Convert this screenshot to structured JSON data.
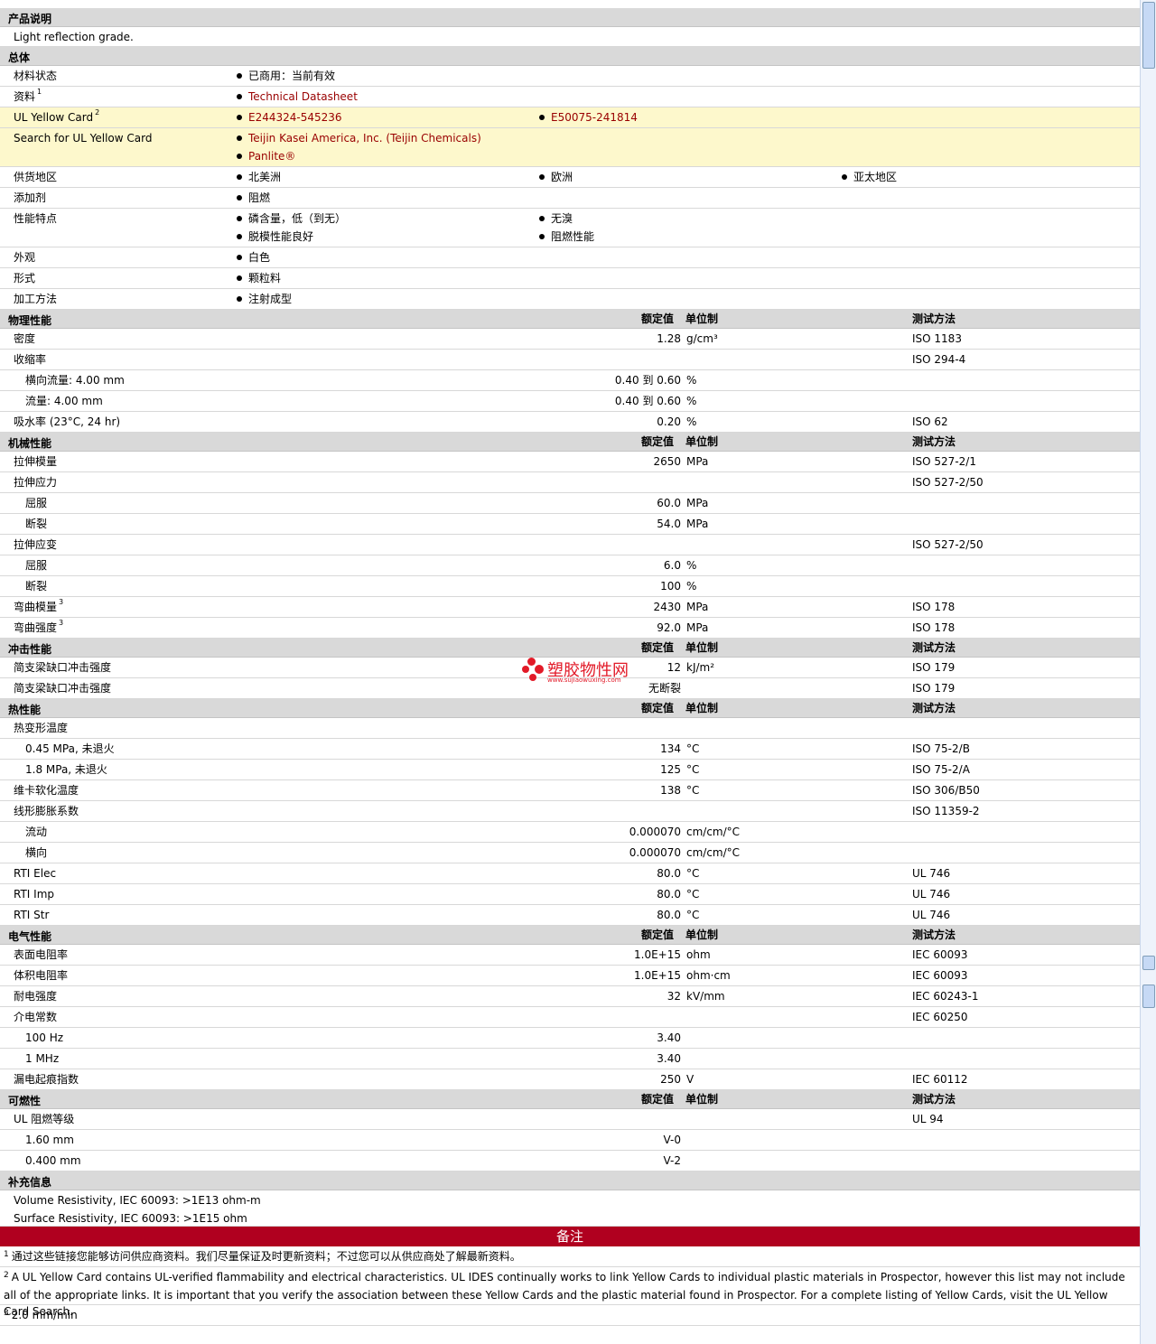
{
  "sections": {
    "desc": "产品说明",
    "general": "总体",
    "physical": "物理性能",
    "mechanical": "机械性能",
    "impact": "冲击性能",
    "thermal": "热性能",
    "electrical": "电气性能",
    "flammability": "可燃性",
    "supplemental": "补充信息"
  },
  "col_headers": {
    "value": "额定值",
    "unit": "单位制",
    "method": "测试方法"
  },
  "description": "Light reflection grade.",
  "general": {
    "status_label": "材料状态",
    "status_value": "已商用：当前有效",
    "docs_label": "资料",
    "docs_sup": "1",
    "docs_value": "Technical Datasheet",
    "ul_label": "UL Yellow Card",
    "ul_sup": "2",
    "ul_links": [
      "E244324-545236",
      "E50075-241814"
    ],
    "search_label": "Search for UL Yellow Card",
    "search_links": [
      "Teijin Kasei America, Inc. (Teijin Chemicals)",
      "Panlite®"
    ],
    "region_label": "供货地区",
    "regions": [
      "北美洲",
      "欧洲",
      "亚太地区"
    ],
    "additive_label": "添加剂",
    "additive": "阻燃",
    "features_label": "性能特点",
    "features": [
      "磷含量，低（到无）",
      "无溴",
      "脱模性能良好",
      "阻燃性能"
    ],
    "appearance_label": "外观",
    "appearance": "白色",
    "form_label": "形式",
    "form": "颗粒料",
    "process_label": "加工方法",
    "process": "注射成型"
  },
  "physical": [
    {
      "label": "密度",
      "value": "1.28",
      "unit": "g/cm³",
      "method": "ISO 1183"
    },
    {
      "label": "收缩率",
      "value": "",
      "unit": "",
      "method": "ISO 294-4"
    },
    {
      "label": "横向流量: 4.00 mm",
      "value": "0.40 到  0.60",
      "unit": "%",
      "method": ""
    },
    {
      "label": "流量: 4.00 mm",
      "value": "0.40 到  0.60",
      "unit": "%",
      "method": ""
    },
    {
      "label": "吸水率 (23°C, 24 hr)",
      "value": "0.20",
      "unit": "%",
      "method": "ISO 62"
    }
  ],
  "mechanical": [
    {
      "label": "拉伸模量",
      "value": "2650",
      "unit": "MPa",
      "method": "ISO 527-2/1"
    },
    {
      "label": "拉伸应力",
      "value": "",
      "unit": "",
      "method": "ISO 527-2/50"
    },
    {
      "label": "屈服",
      "value": "60.0",
      "unit": "MPa",
      "method": ""
    },
    {
      "label": "断裂",
      "value": "54.0",
      "unit": "MPa",
      "method": ""
    },
    {
      "label": "拉伸应变",
      "value": "",
      "unit": "",
      "method": "ISO 527-2/50"
    },
    {
      "label": "屈服",
      "value": "6.0",
      "unit": "%",
      "method": ""
    },
    {
      "label": "断裂",
      "value": "100",
      "unit": "%",
      "method": ""
    },
    {
      "label": "弯曲模量",
      "sup": "3",
      "value": "2430",
      "unit": "MPa",
      "method": "ISO 178"
    },
    {
      "label": "弯曲强度",
      "sup": "3",
      "value": "92.0",
      "unit": "MPa",
      "method": "ISO 178"
    }
  ],
  "impact": [
    {
      "label": "简支梁缺口冲击强度",
      "value": "12",
      "unit": "kJ/m²",
      "method": "ISO 179"
    },
    {
      "label": "简支梁缺口冲击强度",
      "value": "无断裂",
      "unit": "",
      "method": "ISO 179"
    }
  ],
  "thermal": [
    {
      "label": "热变形温度",
      "value": "",
      "unit": "",
      "method": ""
    },
    {
      "label": "0.45 MPa, 未退火",
      "value": "134",
      "unit": "°C",
      "method": "ISO 75-2/B"
    },
    {
      "label": "1.8 MPa, 未退火",
      "value": "125",
      "unit": "°C",
      "method": "ISO 75-2/A"
    },
    {
      "label": "维卡软化温度",
      "value": "138",
      "unit": "°C",
      "method": "ISO 306/B50"
    },
    {
      "label": "线形膨胀系数",
      "value": "",
      "unit": "",
      "method": "ISO 11359-2"
    },
    {
      "label": "流动",
      "value": "0.000070",
      "unit": "cm/cm/°C",
      "method": ""
    },
    {
      "label": "横向",
      "value": "0.000070",
      "unit": "cm/cm/°C",
      "method": ""
    },
    {
      "label": "RTI Elec",
      "value": "80.0",
      "unit": "°C",
      "method": "UL 746"
    },
    {
      "label": "RTI Imp",
      "value": "80.0",
      "unit": "°C",
      "method": "UL 746"
    },
    {
      "label": "RTI Str",
      "value": "80.0",
      "unit": "°C",
      "method": "UL 746"
    }
  ],
  "electrical": [
    {
      "label": "表面电阻率",
      "value": "1.0E+15",
      "unit": "ohm",
      "method": "IEC 60093"
    },
    {
      "label": "体积电阻率",
      "value": "1.0E+15",
      "unit": "ohm·cm",
      "method": "IEC 60093"
    },
    {
      "label": "耐电强度",
      "value": "32",
      "unit": "kV/mm",
      "method": "IEC 60243-1"
    },
    {
      "label": "介电常数",
      "value": "",
      "unit": "",
      "method": "IEC 60250"
    },
    {
      "label": "100 Hz",
      "value": "3.40",
      "unit": "",
      "method": ""
    },
    {
      "label": "1 MHz",
      "value": "3.40",
      "unit": "",
      "method": ""
    },
    {
      "label": "漏电起痕指数",
      "value": "250",
      "unit": "V",
      "method": "IEC 60112"
    }
  ],
  "flammability": [
    {
      "label": "UL 阻燃等级",
      "value": "",
      "unit": "",
      "method": "UL 94"
    },
    {
      "label": "1.60 mm",
      "value": "V-0",
      "unit": "",
      "method": ""
    },
    {
      "label": "0.400 mm",
      "value": "V-2",
      "unit": "",
      "method": ""
    }
  ],
  "supplemental": [
    "Volume Resistivity, IEC 60093: >1E13 ohm-m",
    "Surface Resistivity, IEC 60093: >1E15 ohm"
  ],
  "notes_title": "备注",
  "footnotes": [
    {
      "num": "1",
      "text": "通过这些链接您能够访问供应商资料。我们尽量保证及时更新资料；不过您可以从供应商处了解最新资料。"
    },
    {
      "num": "2",
      "text": "A UL Yellow Card contains UL-verified flammability and electrical characteristics. UL IDES continually works to link Yellow Cards to individual plastic materials in Prospector, however this list may not include all of the appropriate links. It is important that you verify the association between these Yellow Cards and the plastic material found in Prospector. For a complete listing of Yellow Cards, visit the UL Yellow Card Search."
    },
    {
      "num": "3",
      "text": "2.0 mm/min"
    }
  ],
  "watermark": {
    "title": "塑胶物性网",
    "url": "www.sujiaowuxing.com"
  }
}
